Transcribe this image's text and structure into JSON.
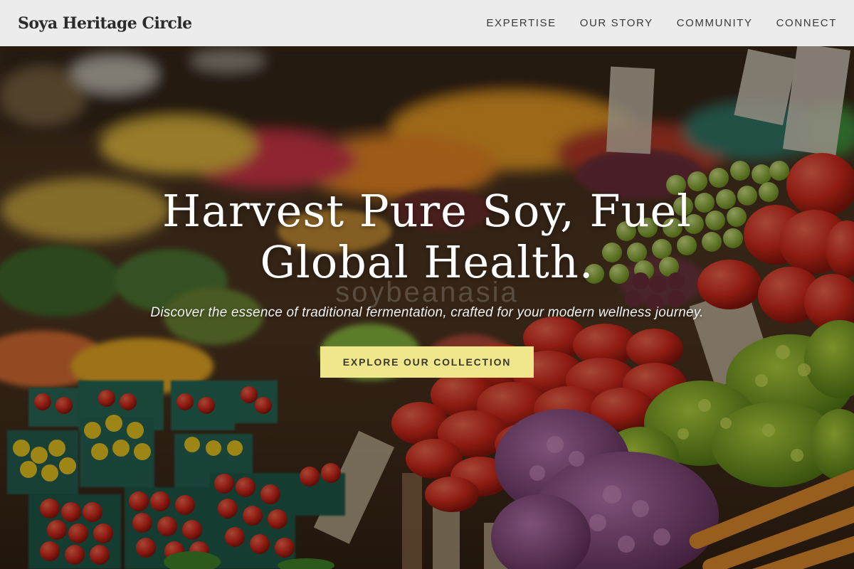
{
  "header": {
    "brand": "Soya Heritage Circle",
    "nav": [
      {
        "label": "EXPERTISE"
      },
      {
        "label": "OUR STORY"
      },
      {
        "label": "COMMUNITY"
      },
      {
        "label": "CONNECT"
      }
    ]
  },
  "hero": {
    "title_line1": "Harvest Pure Soy, Fuel",
    "title_line2": "Global Health.",
    "watermark": "soybeanasia",
    "subtitle": "Discover the essence of traditional fermentation, crafted for your modern wellness journey.",
    "cta_label": "EXPLORE OUR COLLECTION"
  },
  "colors": {
    "header_bg": "#ececec",
    "cta_bg": "#f0e68c",
    "title_text": "#ffffff"
  }
}
